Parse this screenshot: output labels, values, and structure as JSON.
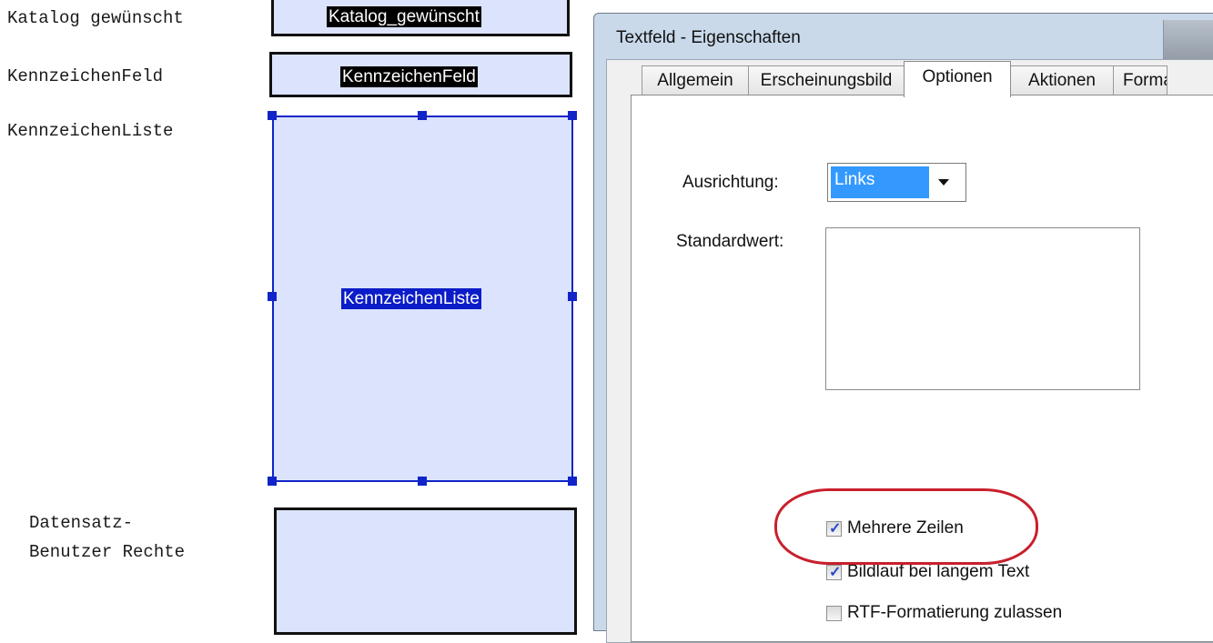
{
  "form_editor": {
    "labels": {
      "katalog": "Katalog gewünscht",
      "kennzeichen_feld": "KennzeichenFeld",
      "kennzeichen_liste": "KennzeichenListe",
      "datensatz_line1": "Datensatz-",
      "datensatz_line2": "Benutzer Rechte"
    },
    "fields": {
      "katalog": "Katalog_gewünscht",
      "kennzeichen_feld": "KennzeichenFeld",
      "kennzeichen_liste": "KennzeichenListe"
    }
  },
  "dialog": {
    "title": "Textfeld - Eigenschaften",
    "tabs": [
      "Allgemein",
      "Erscheinungsbild",
      "Optionen",
      "Aktionen",
      "Format"
    ],
    "active_tab": "Optionen",
    "alignment_label": "Ausrichtung:",
    "alignment_value": "Links",
    "default_value_label": "Standardwert:",
    "default_value": "",
    "checkboxes": [
      {
        "label": "Mehrere Zeilen",
        "checked": true
      },
      {
        "label": "Bildlauf bei langem Text",
        "checked": true
      },
      {
        "label": "RTF-Formatierung zulassen",
        "checked": false
      }
    ]
  },
  "colors": {
    "field_fill": "#dbe3fd",
    "selection": "#1024c8",
    "select_highlight": "#3399ff",
    "annotation": "#c8202c"
  }
}
